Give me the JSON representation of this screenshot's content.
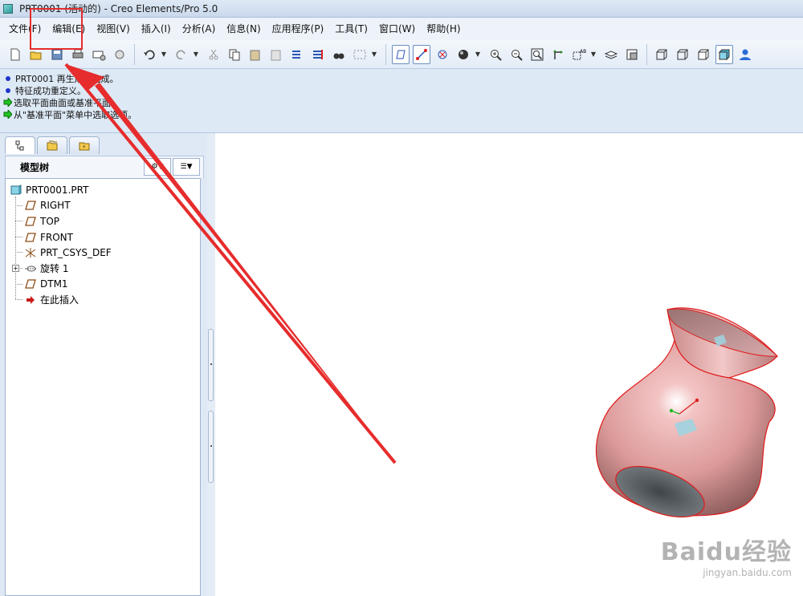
{
  "window": {
    "title": "PRT0001 (活动的) - Creo Elements/Pro 5.0"
  },
  "menu": [
    "文件(F)",
    "编辑(E)",
    "视图(V)",
    "插入(I)",
    "分析(A)",
    "信息(N)",
    "应用程序(P)",
    "工具(T)",
    "窗口(W)",
    "帮助(H)"
  ],
  "messages": [
    {
      "type": "info",
      "text": "PRT0001 再生成功完成。"
    },
    {
      "type": "info",
      "text": "特征成功重定义。"
    },
    {
      "type": "prompt",
      "text": "选取平面曲面或基准平面。"
    },
    {
      "type": "prompt",
      "text": "从\"基准平面\"菜单中选取选项。"
    }
  ],
  "model_tree": {
    "label": "模型树",
    "items": [
      {
        "text": "PRT0001.PRT",
        "icon": "part-icon"
      },
      {
        "text": "RIGHT",
        "icon": "datum-plane-icon"
      },
      {
        "text": "TOP",
        "icon": "datum-plane-icon"
      },
      {
        "text": "FRONT",
        "icon": "datum-plane-icon"
      },
      {
        "text": "PRT_CSYS_DEF",
        "icon": "csys-icon"
      },
      {
        "text": "旋转 1",
        "icon": "revolve-icon"
      },
      {
        "text": "DTM1",
        "icon": "datum-plane-icon"
      },
      {
        "text": "在此插入",
        "icon": "insert-here-icon"
      }
    ]
  },
  "watermark": {
    "brand": "Baidu经验",
    "url": "jingyan.baidu.com"
  },
  "colors": {
    "model": "#e8a9a9",
    "edge": "#e01b1b",
    "annotation": "#e62c2c"
  }
}
